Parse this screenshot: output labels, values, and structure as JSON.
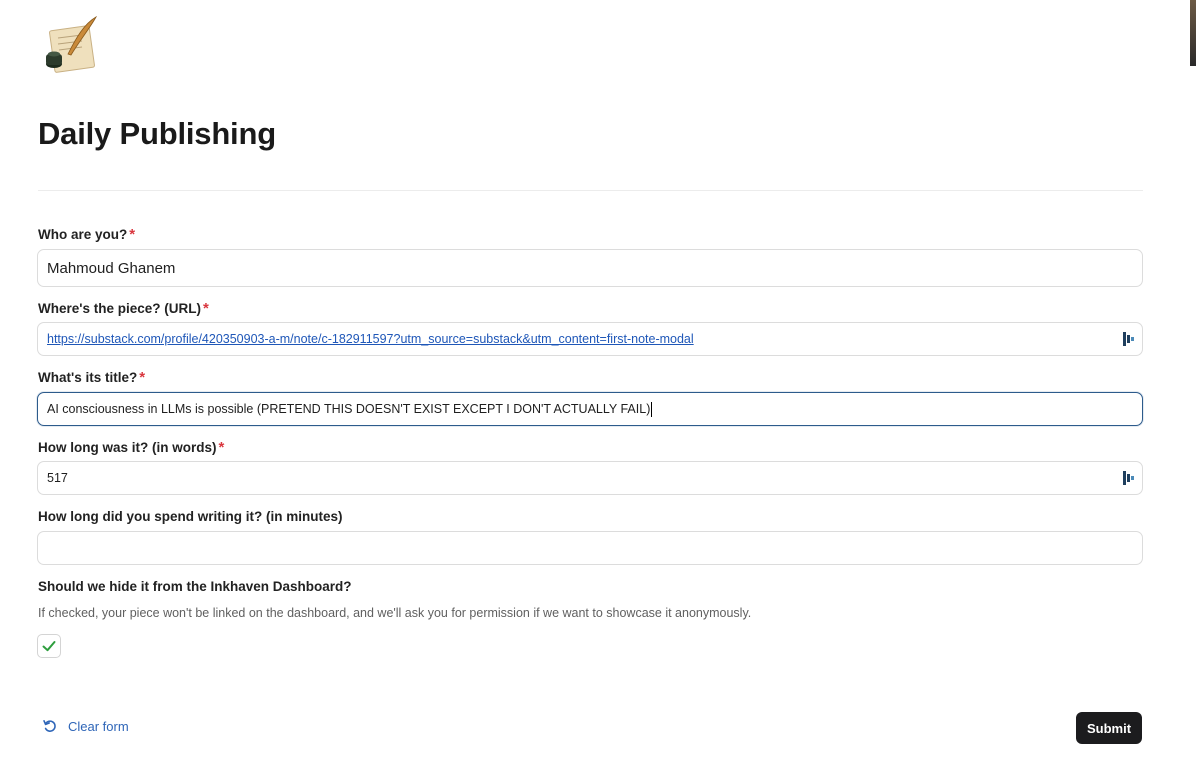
{
  "form": {
    "title": "Daily Publishing",
    "fields": {
      "name": {
        "label": "Who are you?",
        "required_mark": "*",
        "value": "Mahmoud Ghanem"
      },
      "url": {
        "label": "Where's the piece? (URL)",
        "required_mark": "*",
        "value": "https://substack.com/profile/420350903-a-m/note/c-182911597?utm_source=substack&utm_content=first-note-modal"
      },
      "title": {
        "label": "What's its title?",
        "required_mark": "*",
        "value": "AI consciousness in LLMs is possible (PRETEND THIS DOESN'T EXIST EXCEPT I DON'T ACTUALLY FAIL)"
      },
      "words": {
        "label": "How long was it? (in words)",
        "required_mark": "*",
        "value": "517"
      },
      "minutes": {
        "label": "How long did you spend writing it? (in minutes)",
        "value": ""
      }
    },
    "hide": {
      "label": "Should we hide it from the Inkhaven Dashboard?",
      "help": "If checked, your piece won't be linked on the dashboard, and we'll ask you for permission if we want to showcase it anonymously.",
      "checked": true
    },
    "clear_label": "Clear form",
    "submit_label": "Submit"
  },
  "colors": {
    "required": "#d9363e",
    "link": "#1f57b8",
    "focus_border": "#2d5b8c",
    "submit_bg": "#1c1c1e",
    "checkmark": "#2e9e3e"
  },
  "icons": {
    "logo": "quill-and-inkwell-icon",
    "field_action": "password-manager-icon",
    "clear": "undo-icon",
    "checkbox": "checkmark-icon"
  }
}
